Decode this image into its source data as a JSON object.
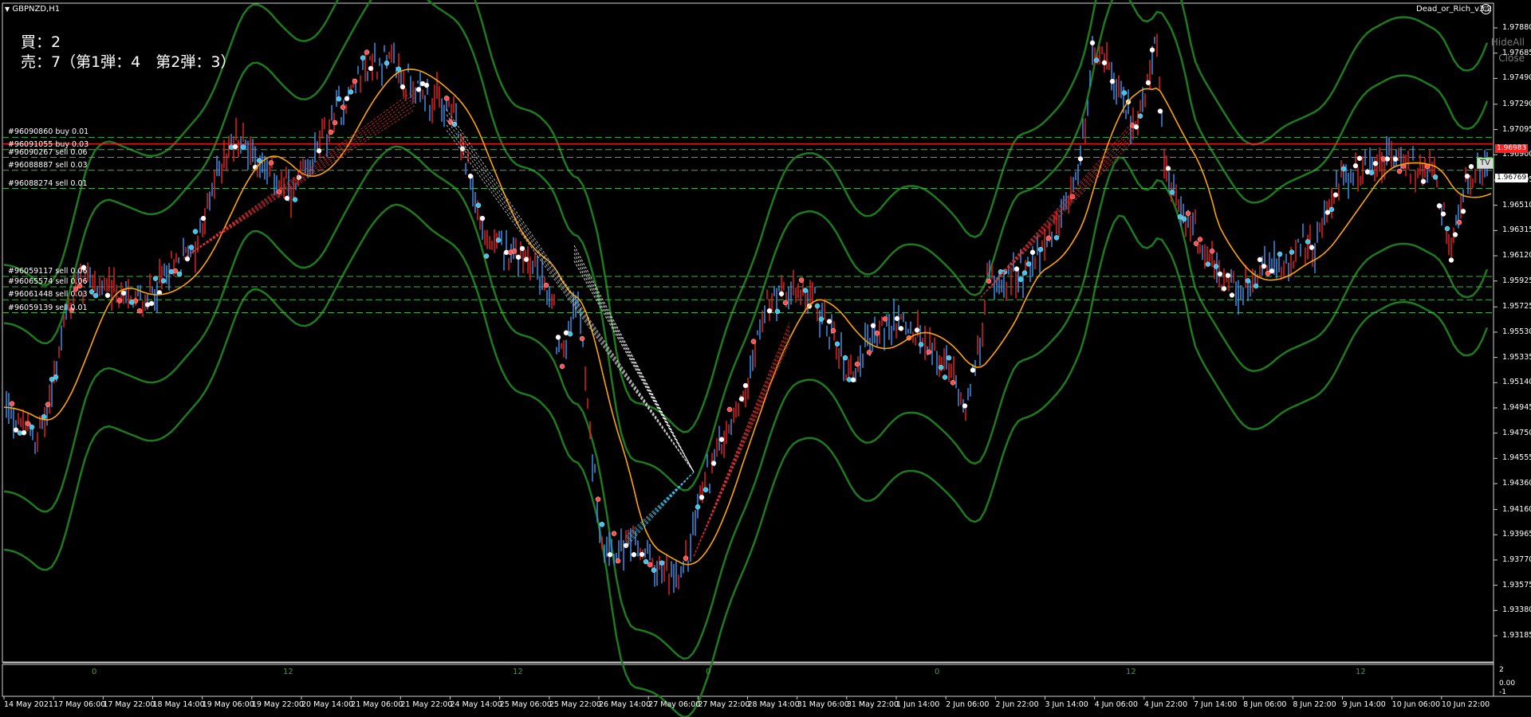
{
  "window": {
    "title": "GBPNZD,H1",
    "menu_arrow": "triangle-down-icon"
  },
  "ea": {
    "name": "Dead_or_Rich_v3.2",
    "icon": "smiley-icon"
  },
  "positions": {
    "buy_line": "買：2",
    "sell_line": "売：7（第1弾：4　第2弾：3）"
  },
  "buttons": {
    "hide_all": "HideAll",
    "close": "Close"
  },
  "orders": [
    {
      "label": "#96090860 buy 0.01",
      "price": 1.97035
    },
    {
      "label": "#96091055 buy 0.03",
      "price": 1.9694
    },
    {
      "label": "#96090267 sell 0.06",
      "price": 1.9688
    },
    {
      "label": "#96088887 sell 0.03",
      "price": 1.9678
    },
    {
      "label": "#96088274 sell 0.01",
      "price": 1.9664
    },
    {
      "label": "#96059117 sell 0.06",
      "price": 1.9596
    },
    {
      "label": "#96065574 sell 0.06",
      "price": 1.9588
    },
    {
      "label": "#96061448 sell 0.03",
      "price": 1.9578
    },
    {
      "label": "#96059139 sell 0.01",
      "price": 1.9568
    }
  ],
  "price_axis": [
    "1.97880",
    "1.97685",
    "1.97490",
    "1.97290",
    "1.97095",
    "1.96900",
    "1.96705",
    "1.96510",
    "1.96315",
    "1.96120",
    "1.95925",
    "1.95725",
    "1.95530",
    "1.95335",
    "1.95140",
    "1.94945",
    "1.94750",
    "1.94555",
    "1.94360",
    "1.94160",
    "1.93965",
    "1.93770",
    "1.93575",
    "1.93380",
    "1.93185"
  ],
  "price_tags": {
    "ask": {
      "value": "1.96983",
      "color": "#ff2020"
    },
    "bid": {
      "value": "1.96769",
      "color": "#ffffff"
    },
    "tv": "TV"
  },
  "time_axis": [
    "14 May 2021",
    "17 May 06:00",
    "17 May 22:00",
    "18 May 14:00",
    "19 May 06:00",
    "19 May 22:00",
    "20 May 14:00",
    "21 May 06:00",
    "21 May 22:00",
    "24 May 14:00",
    "25 May 06:00",
    "25 May 22:00",
    "26 May 14:00",
    "27 May 06:00",
    "27 May 22:00",
    "28 May 14:00",
    "31 May 06:00",
    "31 May 22:00",
    "1 Jun 14:00",
    "2 Jun 06:00",
    "2 Jun 22:00",
    "3 Jun 14:00",
    "4 Jun 06:00",
    "4 Jun 22:00",
    "7 Jun 14:00",
    "8 Jun 06:00",
    "8 Jun 22:00",
    "9 Jun 14:00",
    "10 Jun 06:00",
    "10 Jun 22:00"
  ],
  "subwindow": {
    "labels": [
      "0",
      "12",
      "12",
      "0",
      "0",
      "12",
      "12"
    ],
    "axis": [
      "2",
      "0.00",
      "-1"
    ]
  },
  "colors": {
    "background": "#000000",
    "bull_candle": "#3a8ee6",
    "bear_candle": "#e02020",
    "ma": "#ffa500",
    "bands": "#1e7a1e",
    "order_line": "#3cb43c",
    "ask_line": "#ff2020"
  }
}
